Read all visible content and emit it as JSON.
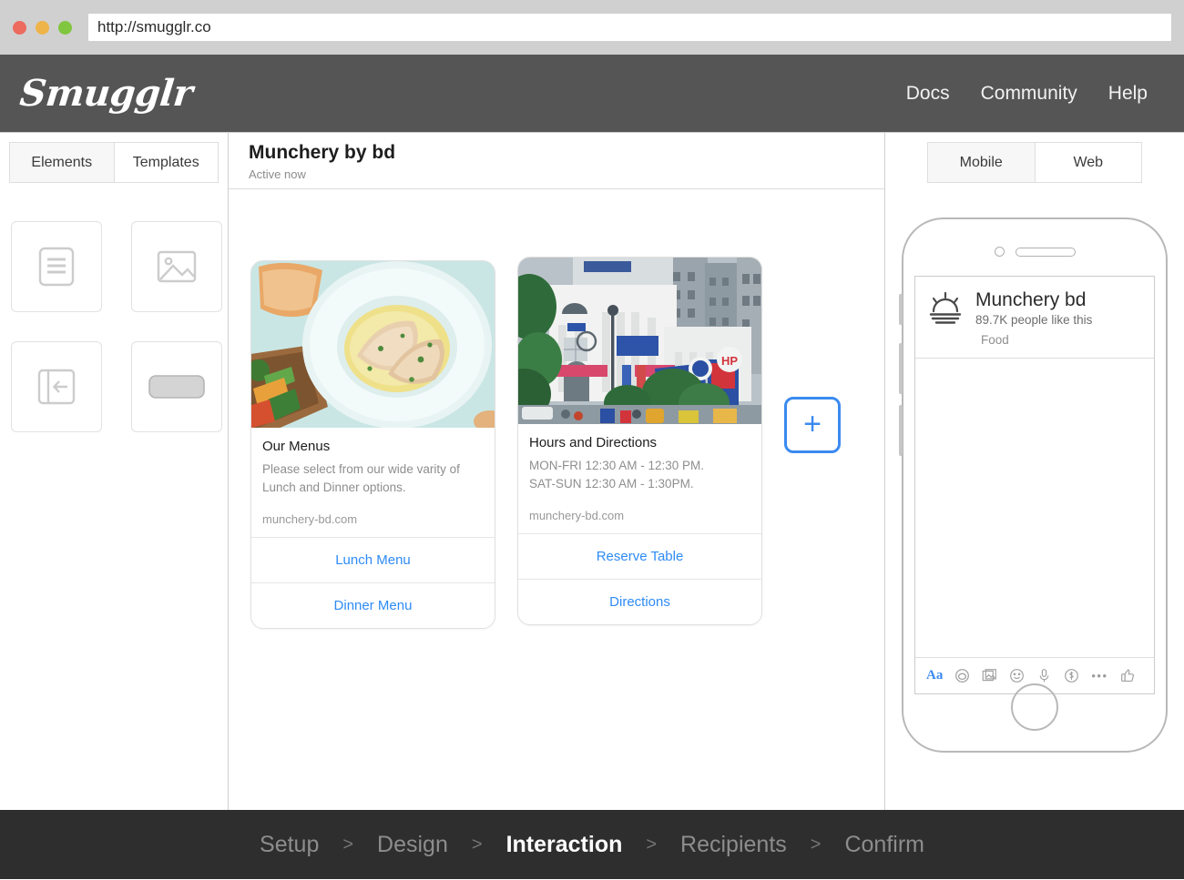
{
  "browser": {
    "url": "http://smugglr.co",
    "traffic_lights": [
      "red",
      "yellow",
      "green"
    ]
  },
  "header": {
    "logo": "Smugglr",
    "nav": [
      {
        "label": "Docs"
      },
      {
        "label": "Community"
      },
      {
        "label": "Help"
      }
    ]
  },
  "sidebar": {
    "tabs": [
      {
        "label": "Elements",
        "active": true
      },
      {
        "label": "Templates",
        "active": false
      }
    ],
    "elements": [
      {
        "icon": "text-block-icon"
      },
      {
        "icon": "image-block-icon"
      },
      {
        "icon": "slide-panel-icon"
      },
      {
        "icon": "button-block-icon"
      }
    ]
  },
  "canvas": {
    "title": "Munchery by bd",
    "status": "Active now",
    "add_card_label": "+",
    "cards": [
      {
        "image": "food-plate-photo",
        "title": "Our Menus",
        "description": "Please select from our wide varity of Lunch and Dinner options.",
        "url": "munchery-bd.com",
        "buttons": [
          {
            "label": "Lunch Menu"
          },
          {
            "label": "Dinner Menu"
          }
        ]
      },
      {
        "image": "city-building-photo",
        "title": "Hours and Directions",
        "description": "MON-FRI 12:30 AM - 12:30 PM.\nSAT-SUN 12:30 AM - 1:30PM.",
        "url": "munchery-bd.com",
        "buttons": [
          {
            "label": "Reserve Table"
          },
          {
            "label": "Directions"
          }
        ]
      }
    ]
  },
  "preview": {
    "tabs": [
      {
        "label": "Mobile",
        "active": true
      },
      {
        "label": "Web",
        "active": false
      }
    ],
    "message": {
      "logo_icon": "sunrise-dome-icon",
      "name": "Munchery bd",
      "likes": "89.7K people like this",
      "category": "Food"
    },
    "toolbar_icons": [
      {
        "name": "aa-text-icon",
        "glyph": "Aa"
      },
      {
        "name": "camera-icon"
      },
      {
        "name": "photo-gallery-icon"
      },
      {
        "name": "emoji-icon"
      },
      {
        "name": "microphone-icon"
      },
      {
        "name": "payment-dollar-icon"
      },
      {
        "name": "more-options-icon",
        "glyph": "•••"
      },
      {
        "name": "thumbs-up-icon"
      }
    ]
  },
  "steps": {
    "items": [
      {
        "label": "Setup",
        "active": false
      },
      {
        "label": "Design",
        "active": false
      },
      {
        "label": "Interaction",
        "active": true
      },
      {
        "label": "Recipients",
        "active": false
      },
      {
        "label": "Confirm",
        "active": false
      }
    ],
    "separator": ">"
  },
  "colors": {
    "accent_blue": "#3b8af0",
    "link_blue": "#2e8bf5",
    "header_gray": "#555555",
    "footer_dark": "#2e2e2e",
    "chrome_gray": "#d0d0d0"
  }
}
